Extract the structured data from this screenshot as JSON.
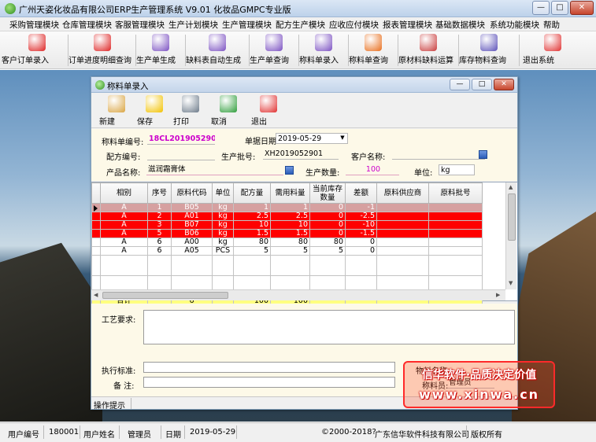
{
  "app": {
    "title": "广州天姿化妆品有限公司ERP生产管理系统  V9.01 化妆品GMPC专业版",
    "minimize": "—",
    "maximize": "□",
    "close": "✕"
  },
  "menus": [
    "采购管理模块",
    "仓库管理模块",
    "客服管理模块",
    "生产计划模块",
    "生产管理模块",
    "配方生产模块",
    "应收应付模块",
    "报表管理模块",
    "基础数据模块",
    "系统功能模块",
    "帮助"
  ],
  "toolbar": [
    {
      "label": "客户订单录入",
      "icon": "pdf-icon",
      "color": "#d22"
    },
    {
      "label": "订单进度明细查询",
      "icon": "pdf-icon",
      "color": "#d22"
    },
    {
      "label": "生产单生成",
      "icon": "quill-icon",
      "color": "#7a4fc1"
    },
    {
      "label": "缺料表自动生成",
      "icon": "quill-icon",
      "color": "#7a4fc1"
    },
    {
      "label": "生产单查询",
      "icon": "quill-icon",
      "color": "#7a4fc1"
    },
    {
      "label": "称料单录入",
      "icon": "quill-icon",
      "color": "#7a4fc1"
    },
    {
      "label": "称料单查询",
      "icon": "flower-icon",
      "color": "#e86d1b"
    },
    {
      "label": "原材料缺料运算",
      "icon": "quill-icon",
      "color": "#c83a3a"
    },
    {
      "label": "库存物料查询",
      "icon": "quill-icon",
      "color": "#5a4fb8"
    },
    {
      "label": "退出系统",
      "icon": "exit-icon",
      "color": "#e03030"
    }
  ],
  "child": {
    "title": "称料单录入",
    "toolbar": [
      {
        "label": "新建",
        "icon": "clipboard-icon",
        "color": "#d9a441"
      },
      {
        "label": "保存",
        "icon": "save-icon",
        "color": "#f2c200"
      },
      {
        "label": "打印",
        "icon": "printer-icon",
        "color": "#6d7b8a"
      },
      {
        "label": "取消",
        "icon": "refresh-icon",
        "color": "#2e9d3a"
      },
      {
        "label": "退出",
        "icon": "exit-icon",
        "color": "#e03030"
      }
    ]
  },
  "form": {
    "order_no_label": "称料单编号:",
    "order_no": "18CL20190529001",
    "date_label": "单据日期:",
    "date": "2019-05-29",
    "formula_label": "配方编号:",
    "formula": "",
    "batch_label": "生产批号:",
    "batch": "XH2019052901",
    "customer_label": "客户名称:",
    "customer": "",
    "product_label": "产品名称:",
    "product": "滋润霜膏体",
    "qty_label": "生产数量:",
    "qty": "100",
    "unit_label": "单位:",
    "unit": "kg"
  },
  "grid": {
    "headers": [
      "相别",
      "序号",
      "原料代码",
      "单位",
      "配方量",
      "需用料量",
      "当前库存数量",
      "差额",
      "原料供应商",
      "原料批号"
    ],
    "rows": [
      {
        "style": "sel",
        "cells": [
          "A",
          "1",
          "B05",
          "kg",
          "1",
          "1",
          "0",
          "-1",
          "",
          ""
        ]
      },
      {
        "style": "red",
        "cells": [
          "A",
          "2",
          "A01",
          "kg",
          "2.5",
          "2.5",
          "0",
          "-2.5",
          "",
          ""
        ]
      },
      {
        "style": "red",
        "cells": [
          "A",
          "3",
          "B07",
          "kg",
          "10",
          "10",
          "0",
          "-10",
          "",
          ""
        ]
      },
      {
        "style": "red",
        "cells": [
          "A",
          "5",
          "B06",
          "kg",
          "1.5",
          "1.5",
          "0",
          "-1.5",
          "",
          ""
        ]
      },
      {
        "style": "norm",
        "cells": [
          "A",
          "6",
          "A00",
          "kg",
          "80",
          "80",
          "80",
          "0",
          "",
          ""
        ]
      },
      {
        "style": "norm",
        "cells": [
          "A",
          "6",
          "A05",
          "PCS",
          "5",
          "5",
          "5",
          "0",
          "",
          ""
        ]
      }
    ],
    "total": [
      "合计",
      "",
      "6",
      "",
      "100",
      "100",
      "",
      "",
      "",
      ""
    ]
  },
  "memo": {
    "craft_label": "工艺要求:",
    "standard_label": "执行标准:",
    "notes_label": "备    注:",
    "material_name_label": "物料名称:",
    "weigher_label": "称料员:",
    "weigher": "管理员"
  },
  "child_status": {
    "hint": "操作提示"
  },
  "watermark": {
    "line1": "信华软件·品质决定价值",
    "line2": "www.xinwa.cn"
  },
  "status": {
    "user_no_label": "用户编号",
    "user_no": "180001",
    "user_name_label": "用户姓名",
    "user_name": "管理员",
    "date_label": "日期",
    "date": "2019-05-29",
    "copyright": "©2000-2018?",
    "company": "广东信华软件科技有限公司",
    "rights": "版权所有"
  },
  "colors": {
    "accent": "#3b6ea8",
    "highlight_row": "#ff0000",
    "total_row": "#ffff80",
    "order_no": "#cc00cc"
  }
}
